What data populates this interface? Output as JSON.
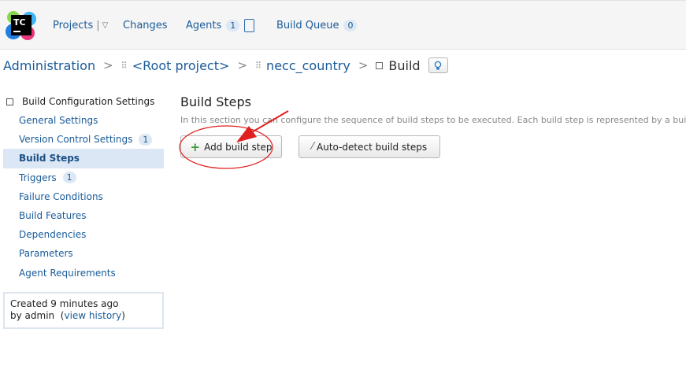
{
  "logo": {
    "text": "TC",
    "icon": "teamcity-logo"
  },
  "nav": {
    "projects": "Projects",
    "projects_separator": "|",
    "projects_caret": "▽",
    "changes": "Changes",
    "agents": "Agents",
    "agents_count": "1",
    "build_queue": "Build Queue",
    "build_queue_count": "0"
  },
  "breadcrumb": {
    "admin": "Administration",
    "root_project": "<Root project>",
    "project": "necc_country",
    "current": "Build",
    "separator": ">"
  },
  "sidebar": {
    "heading": "Build Configuration Settings",
    "items": [
      {
        "label": "General Settings",
        "count": ""
      },
      {
        "label": "Version Control Settings",
        "count": "1"
      },
      {
        "label": "Build Steps",
        "count": "",
        "active": true
      },
      {
        "label": "Triggers",
        "count": "1"
      },
      {
        "label": "Failure Conditions",
        "count": ""
      },
      {
        "label": "Build Features",
        "count": ""
      },
      {
        "label": "Dependencies",
        "count": ""
      },
      {
        "label": "Parameters",
        "count": ""
      },
      {
        "label": "Agent Requirements",
        "count": ""
      }
    ],
    "created": {
      "line1": "Created 9 minutes ago",
      "by": "by admin",
      "open_paren": "(",
      "link": "view history",
      "close_paren": ")"
    }
  },
  "main": {
    "title": "Build Steps",
    "description": "In this section you can configure the sequence of build steps to be executed. Each build step is represented by a build",
    "add_button": "Add build step",
    "add_icon": "+",
    "auto_button": "Auto-detect build steps"
  },
  "colors": {
    "link": "#1a5b99",
    "active_bg": "#dbe7f5",
    "annotation": "#e02020"
  }
}
